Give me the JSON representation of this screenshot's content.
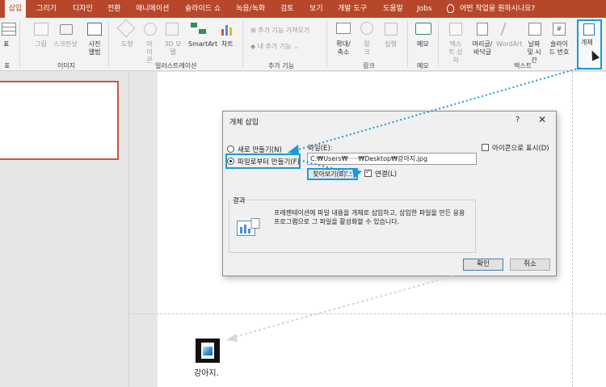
{
  "tabs": [
    {
      "label": "삽입",
      "active": true
    },
    {
      "label": "그리기"
    },
    {
      "label": "디자인"
    },
    {
      "label": "전환"
    },
    {
      "label": "애니메이션"
    },
    {
      "label": "슬라이드 쇼"
    },
    {
      "label": "녹음/녹화"
    },
    {
      "label": "검토"
    },
    {
      "label": "보기"
    },
    {
      "label": "개발 도구"
    },
    {
      "label": "도움말"
    },
    {
      "label": "Jobs"
    }
  ],
  "tell_me": "어떤 작업을 원하시나요?",
  "ribbon": {
    "table": {
      "label": "표",
      "group": "표"
    },
    "images": {
      "picture": "그림",
      "screenshot": "스크린샷",
      "album": "사진 앨범",
      "group": "이미지"
    },
    "illustrations": {
      "shapes": "도형",
      "icons": "아이콘",
      "models": "3D 모델",
      "smartart": "SmartArt",
      "chart": "차트",
      "group": "일러스트레이션"
    },
    "addins": {
      "get": "추가 기능 가져오기",
      "my": "내 추가 기능",
      "group": "추가 기능"
    },
    "links": {
      "zoom": "확대/축소",
      "link": "링크",
      "action": "실행",
      "group": "링크"
    },
    "comments": {
      "comment": "메모",
      "group": "메모"
    },
    "text": {
      "textbox": "텍스트 상자",
      "header_footer": "머리글/바닥글",
      "wordart": "WordArt",
      "date_time": "날짜 및 시간",
      "slide_number": "슬라이드 번호",
      "object": "개체",
      "group": "텍스트"
    }
  },
  "dialog": {
    "title": "개체 삽입",
    "help": "?",
    "close": "✕",
    "radio_new": "새로 만들기(N)",
    "radio_file": "파일로부터 만들기(F)",
    "file_label": "파일(E):",
    "file_path": "C:₩Users₩·····₩Desktop₩강아지.jpg",
    "browse": "찾아보기(B)...",
    "link_label": "연결(L)",
    "link_checked": true,
    "display_icon_label": "아이콘으로 표시(D)",
    "display_icon_checked": false,
    "result_label": "결과",
    "result_text": "프레젠테이션에 파일 내용을 개체로 삽입하고, 삽입한 파일을 만든 응용 프로그램으로 그 파일을 활성화할 수 있습니다.",
    "ok": "확인",
    "cancel": "취소"
  },
  "slide": {
    "file_icon_label": "강아지."
  },
  "colors": {
    "accent": "#b7472a",
    "highlight": "#1a9bd7"
  }
}
